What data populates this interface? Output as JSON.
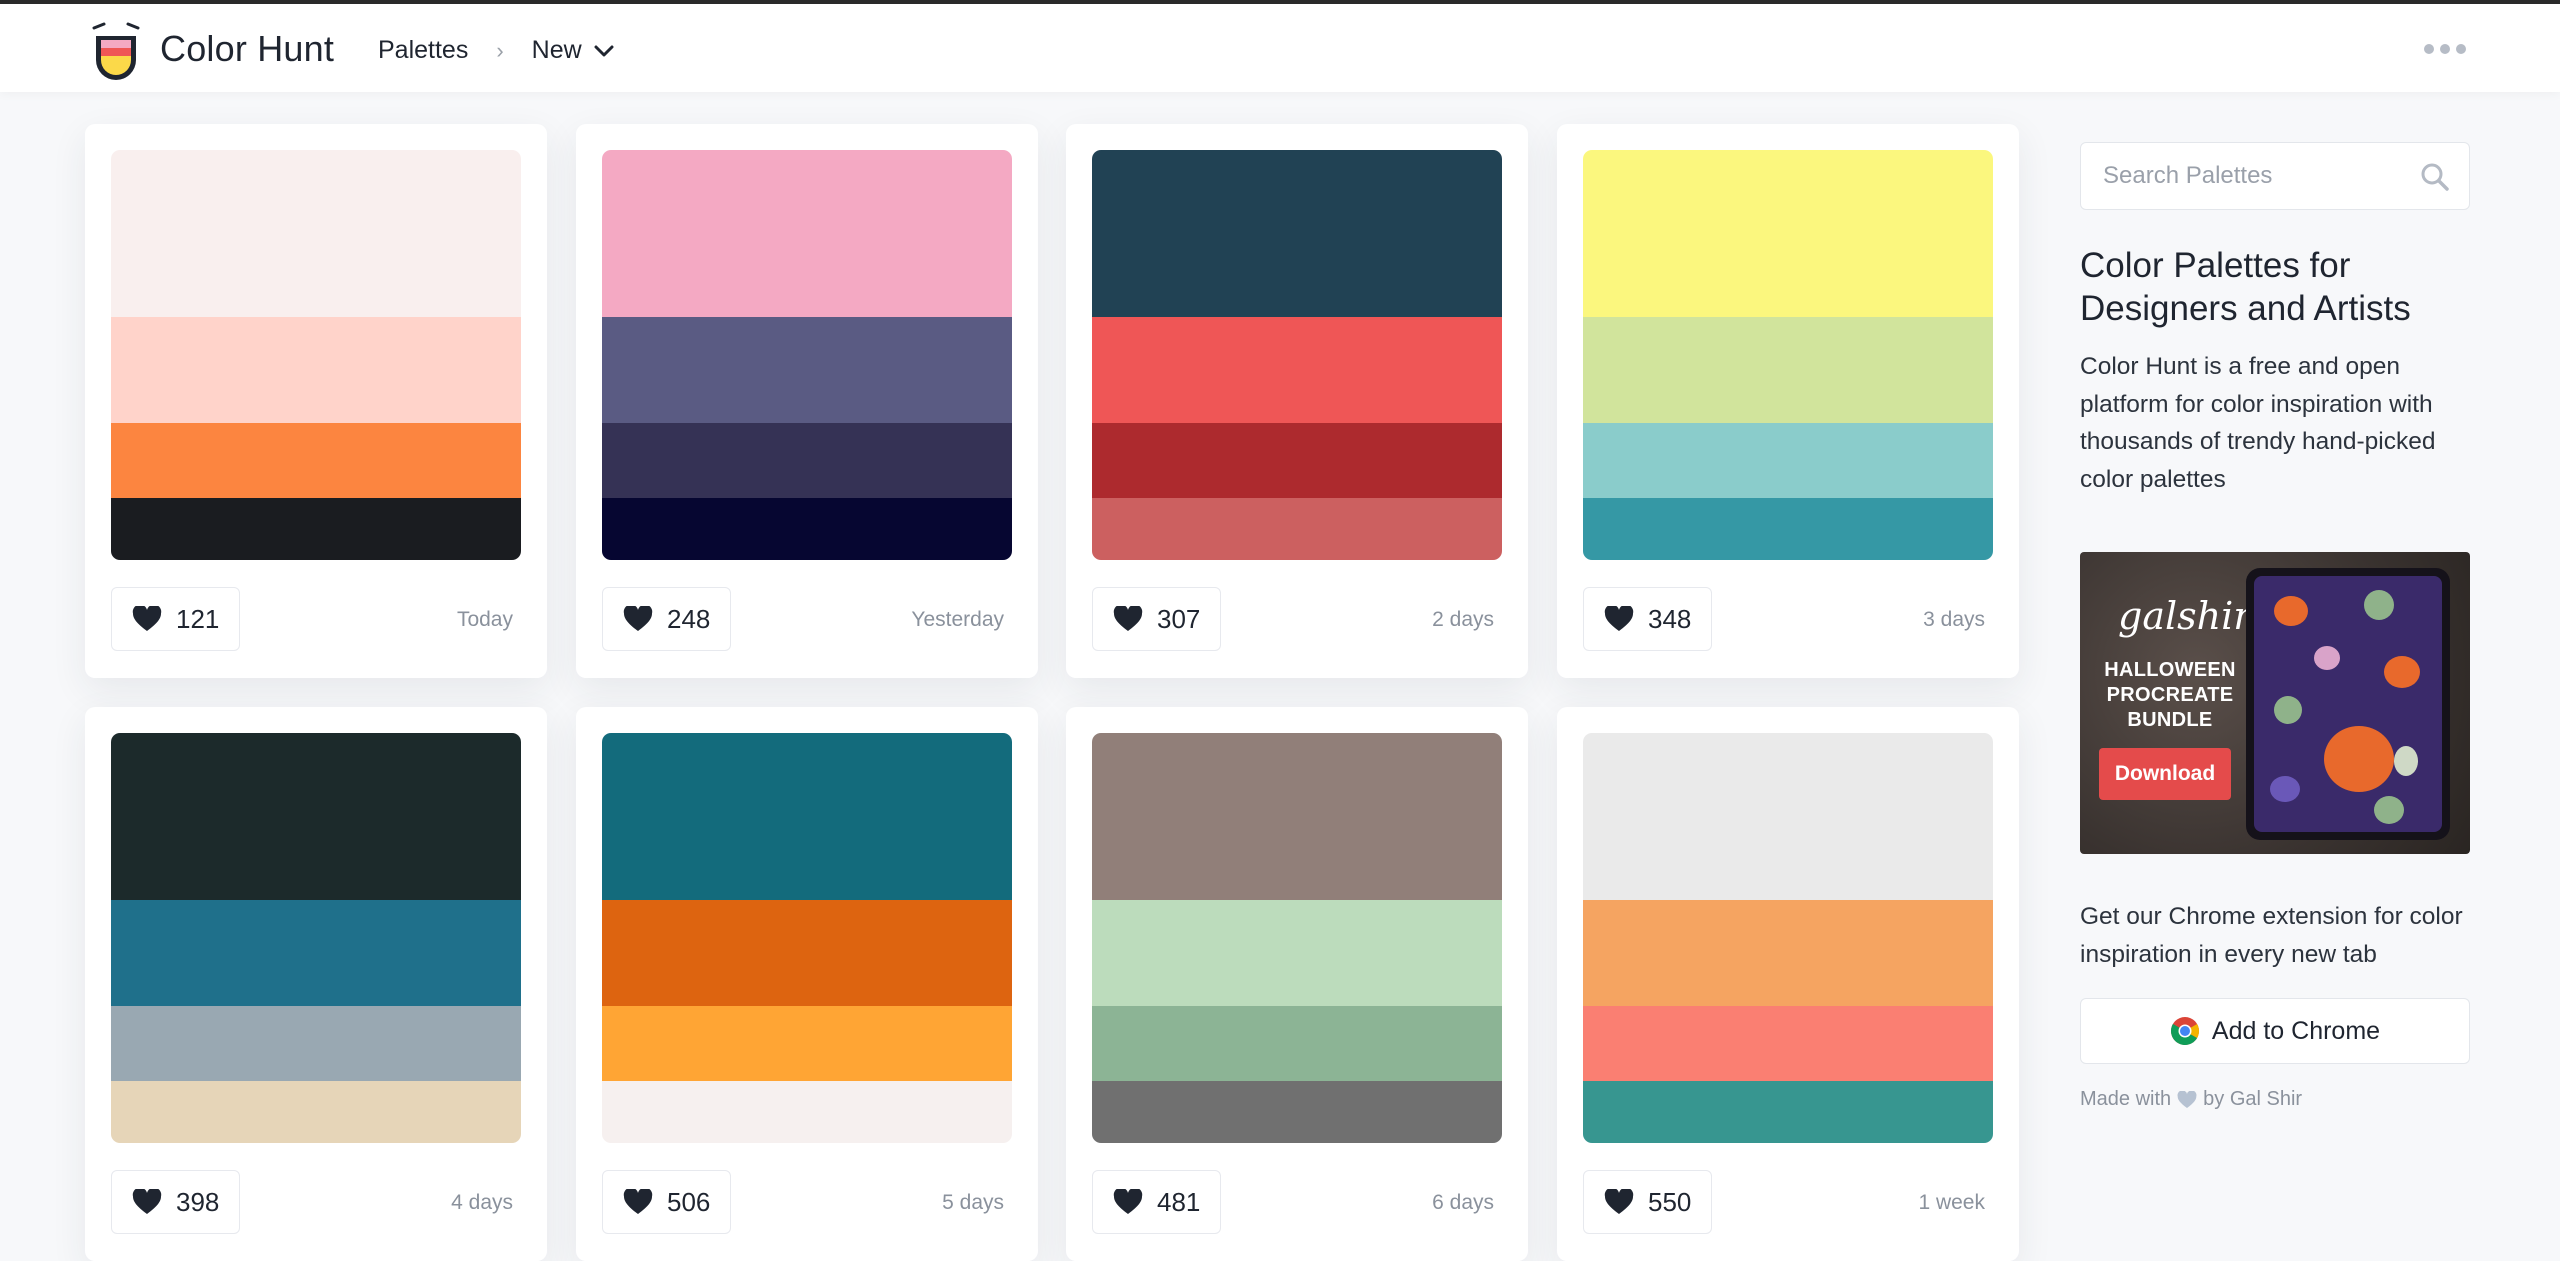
{
  "header": {
    "brand": "Color Hunt",
    "breadcrumb_root": "Palettes",
    "breadcrumb_separator": "›",
    "filter_label": "New",
    "icons": {
      "logo": "color-hunt-logo-icon",
      "chevron": "chevron-down-icon",
      "menu": "more-dots-icon"
    }
  },
  "cards": [
    {
      "colors": [
        "#F9EFEE",
        "#FFD3CA",
        "#FC8540",
        "#1A1C20"
      ],
      "likes": "121",
      "date": "Today"
    },
    {
      "colors": [
        "#F4A9C3",
        "#5A5B83",
        "#353255",
        "#060631"
      ],
      "likes": "248",
      "date": "Yesterday"
    },
    {
      "colors": [
        "#214254",
        "#EF5656",
        "#AD2A2E",
        "#CC6060"
      ],
      "likes": "307",
      "date": "2 days"
    },
    {
      "colors": [
        "#FBF77E",
        "#D1E49C",
        "#8ACCCB",
        "#3598A5"
      ],
      "likes": "348",
      "date": "3 days"
    },
    {
      "colors": [
        "#1C2A2B",
        "#1F708B",
        "#99A8B2",
        "#E6D5B8"
      ],
      "likes": "398",
      "date": "4 days"
    },
    {
      "colors": [
        "#136B7C",
        "#DD6410",
        "#FFA534",
        "#F6F0EF"
      ],
      "likes": "506",
      "date": "5 days"
    },
    {
      "colors": [
        "#917F79",
        "#BCDCBC",
        "#8CB495",
        "#707070"
      ],
      "likes": "481",
      "date": "6 days"
    },
    {
      "colors": [
        "#EAEAEA",
        "#F5A461",
        "#FA7F72",
        "#379690"
      ],
      "likes": "550",
      "date": "1 week"
    }
  ],
  "sidebar": {
    "search_placeholder": "Search Palettes",
    "title": "Color Palettes for Designers and Artists",
    "description": "Color Hunt is a free and open platform for color inspiration with thousands of trendy hand-picked color palettes",
    "ad": {
      "script_text": "galshir",
      "headline": "HALLOWEEN PROCREATE BUNDLE",
      "button": "Download"
    },
    "extension_text": "Get our Chrome extension for color inspiration in every new tab",
    "chrome_button": "Add to Chrome",
    "made_with_prefix": "Made with",
    "made_with_suffix": "by Gal Shir"
  },
  "colors": {
    "heart": "#1f2530",
    "accent_red": "#e44b4b",
    "muted_heart": "#b6c2d2"
  }
}
